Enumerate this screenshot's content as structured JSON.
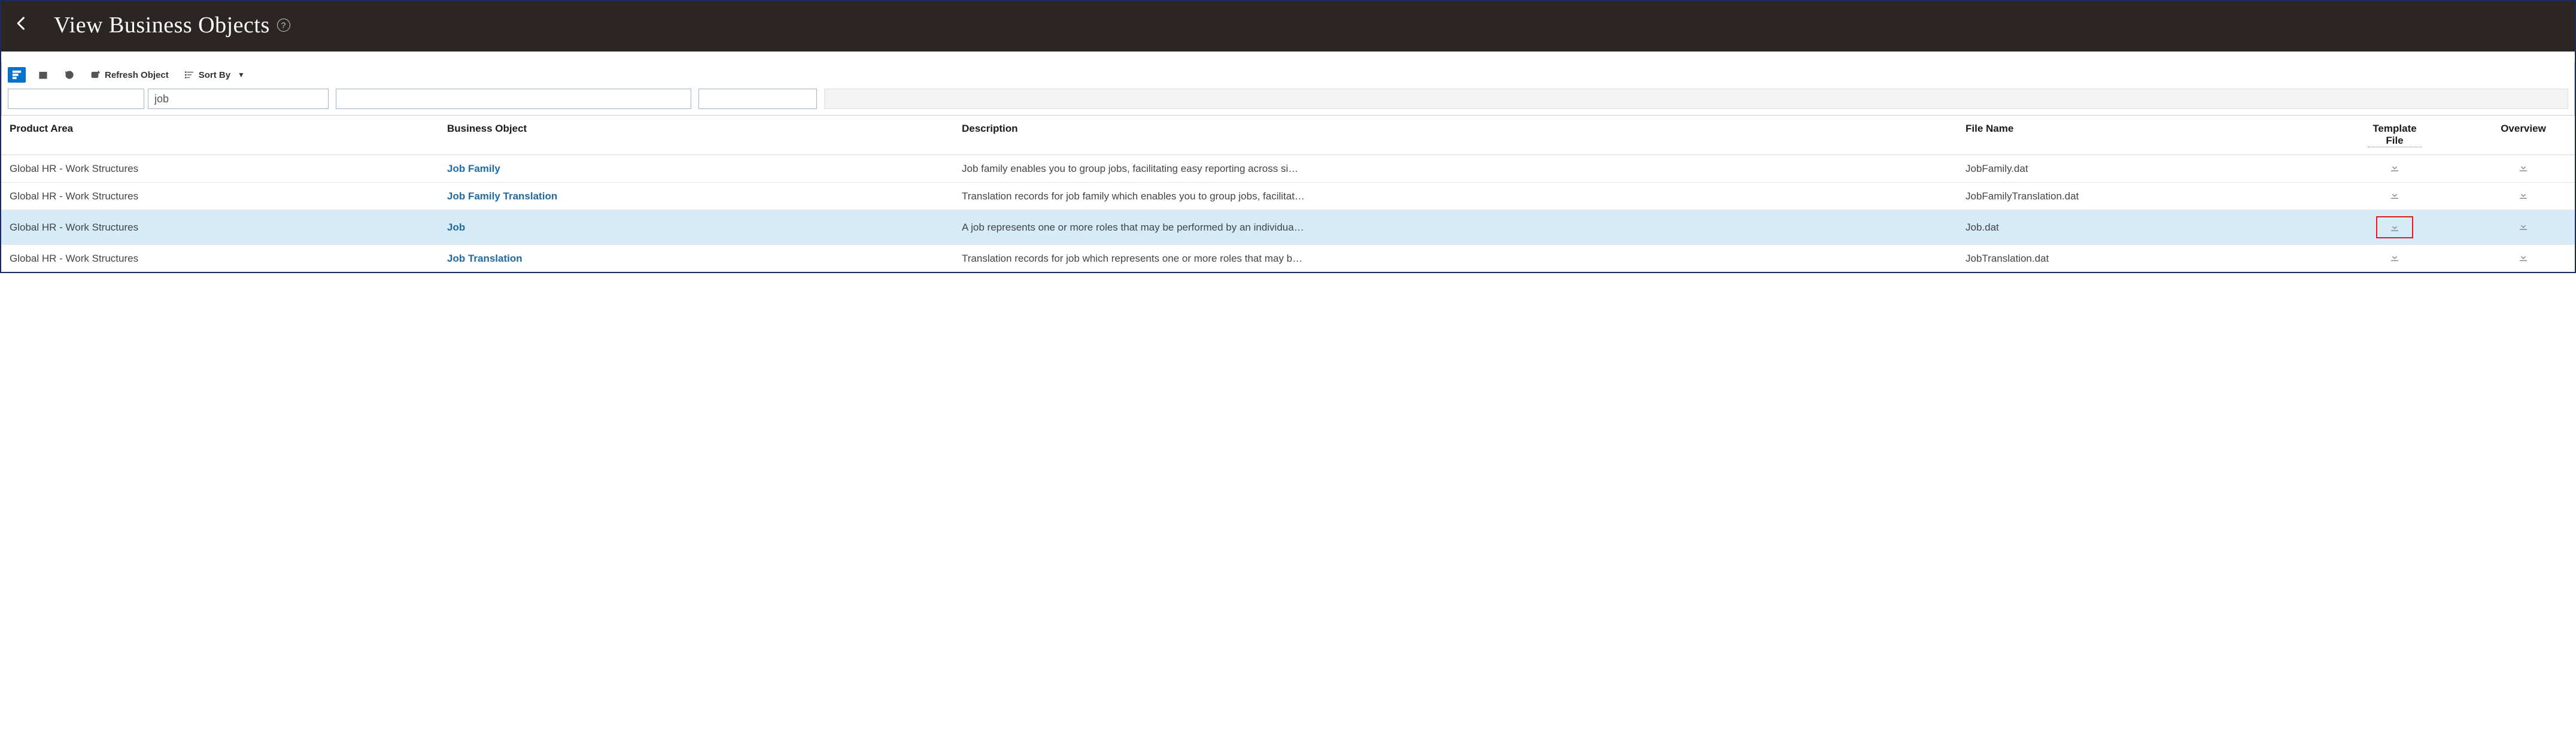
{
  "header": {
    "title": "View Business Objects"
  },
  "toolbar": {
    "refresh_object": "Refresh Object",
    "sort_by": "Sort By"
  },
  "filters": {
    "product_area": "",
    "business_object": "job",
    "description": "",
    "file_name": ""
  },
  "columns": {
    "product_area": "Product Area",
    "business_object": "Business Object",
    "description": "Description",
    "file_name": "File Name",
    "template_file": "Template File",
    "overview": "Overview"
  },
  "rows": [
    {
      "product_area": "Global HR - Work Structures",
      "business_object": "Job Family",
      "description": "Job family enables you to group jobs, facilitating easy reporting across si…",
      "file_name": "JobFamily.dat",
      "selected": false,
      "highlight_template": false
    },
    {
      "product_area": "Global HR - Work Structures",
      "business_object": "Job Family Translation",
      "description": "Translation records for job family which enables you to group jobs, facilitat…",
      "file_name": "JobFamilyTranslation.dat",
      "selected": false,
      "highlight_template": false
    },
    {
      "product_area": "Global HR - Work Structures",
      "business_object": "Job",
      "description": "A job represents one or more roles that may be performed by an individua…",
      "file_name": "Job.dat",
      "selected": true,
      "highlight_template": true
    },
    {
      "product_area": "Global HR - Work Structures",
      "business_object": "Job Translation",
      "description": "Translation records for job which represents one or more roles that may b…",
      "file_name": "JobTranslation.dat",
      "selected": false,
      "highlight_template": false
    }
  ]
}
